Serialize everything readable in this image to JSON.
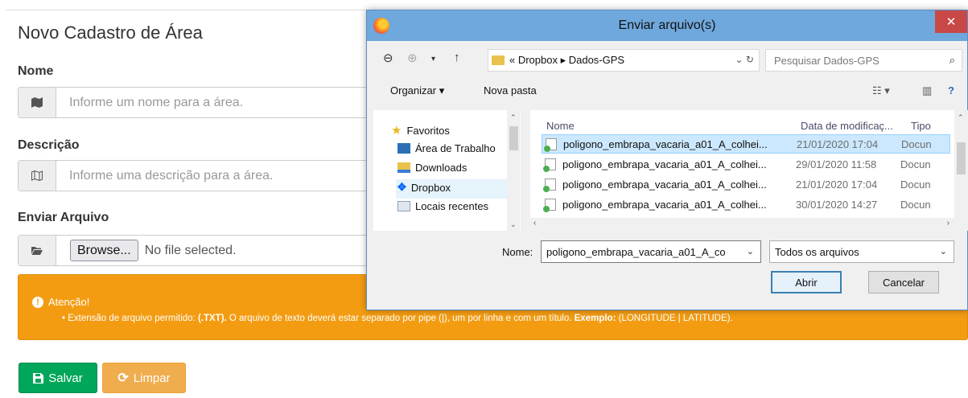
{
  "form": {
    "title": "Novo Cadastro de Área",
    "name_label": "Nome",
    "name_placeholder": "Informe um nome para a área.",
    "desc_label": "Descrição",
    "desc_placeholder": "Informe uma descrição para a área.",
    "file_label": "Enviar Arquivo",
    "browse_label": "Browse...",
    "no_file_text": "No file selected.",
    "alert_title": "Atenção!",
    "alert_part1": "• Extensão de arquivo permitido: ",
    "alert_bold1": "(.TXT).",
    "alert_part2": " O arquivo de texto deverá estar separado por pipe (|), um por linha e com um título. ",
    "alert_bold2": "Exemplo:",
    "alert_part3": " (LONGITUDE | LATITUDE).",
    "save_label": "Salvar",
    "clear_label": "Limpar",
    "colors": {
      "alert": "#f39c12",
      "save": "#00a65a",
      "clear": "#f0ad4e"
    }
  },
  "dialog": {
    "title": "Enviar arquivo(s)",
    "close_glyph": "✕",
    "address": "« Dropbox ▸ Dados-GPS",
    "search_placeholder": "Pesquisar Dados-GPS",
    "organize_label": "Organizar ▾",
    "new_folder_label": "Nova pasta",
    "nav_items": [
      {
        "label": "Favoritos",
        "icon": "star-icon"
      },
      {
        "label": "Área de Trabalho",
        "icon": "desktop-icon"
      },
      {
        "label": "Downloads",
        "icon": "downloads-icon"
      },
      {
        "label": "Dropbox",
        "icon": "dropbox-icon"
      },
      {
        "label": "Locais recentes",
        "icon": "recent-icon"
      }
    ],
    "columns": {
      "name": "Nome",
      "date": "Data de modificaç...",
      "type": "Tipo"
    },
    "files": [
      {
        "name": "poligono_embrapa_vacaria_a01_A_colhei...",
        "date": "21/01/2020 17:04",
        "type": "Docun"
      },
      {
        "name": "poligono_embrapa_vacaria_a01_A_colhei...",
        "date": "29/01/2020 11:58",
        "type": "Docun"
      },
      {
        "name": "poligono_embrapa_vacaria_a01_A_colhei...",
        "date": "21/01/2020 17:04",
        "type": "Docun"
      },
      {
        "name": "poligono_embrapa_vacaria_a01_A_colhei...",
        "date": "30/01/2020 14:27",
        "type": "Docun"
      }
    ],
    "filename_label": "Nome:",
    "filename_value": "poligono_embrapa_vacaria_a01_A_co",
    "filetype_value": "Todos os arquivos",
    "open_label": "Abrir",
    "cancel_label": "Cancelar"
  }
}
